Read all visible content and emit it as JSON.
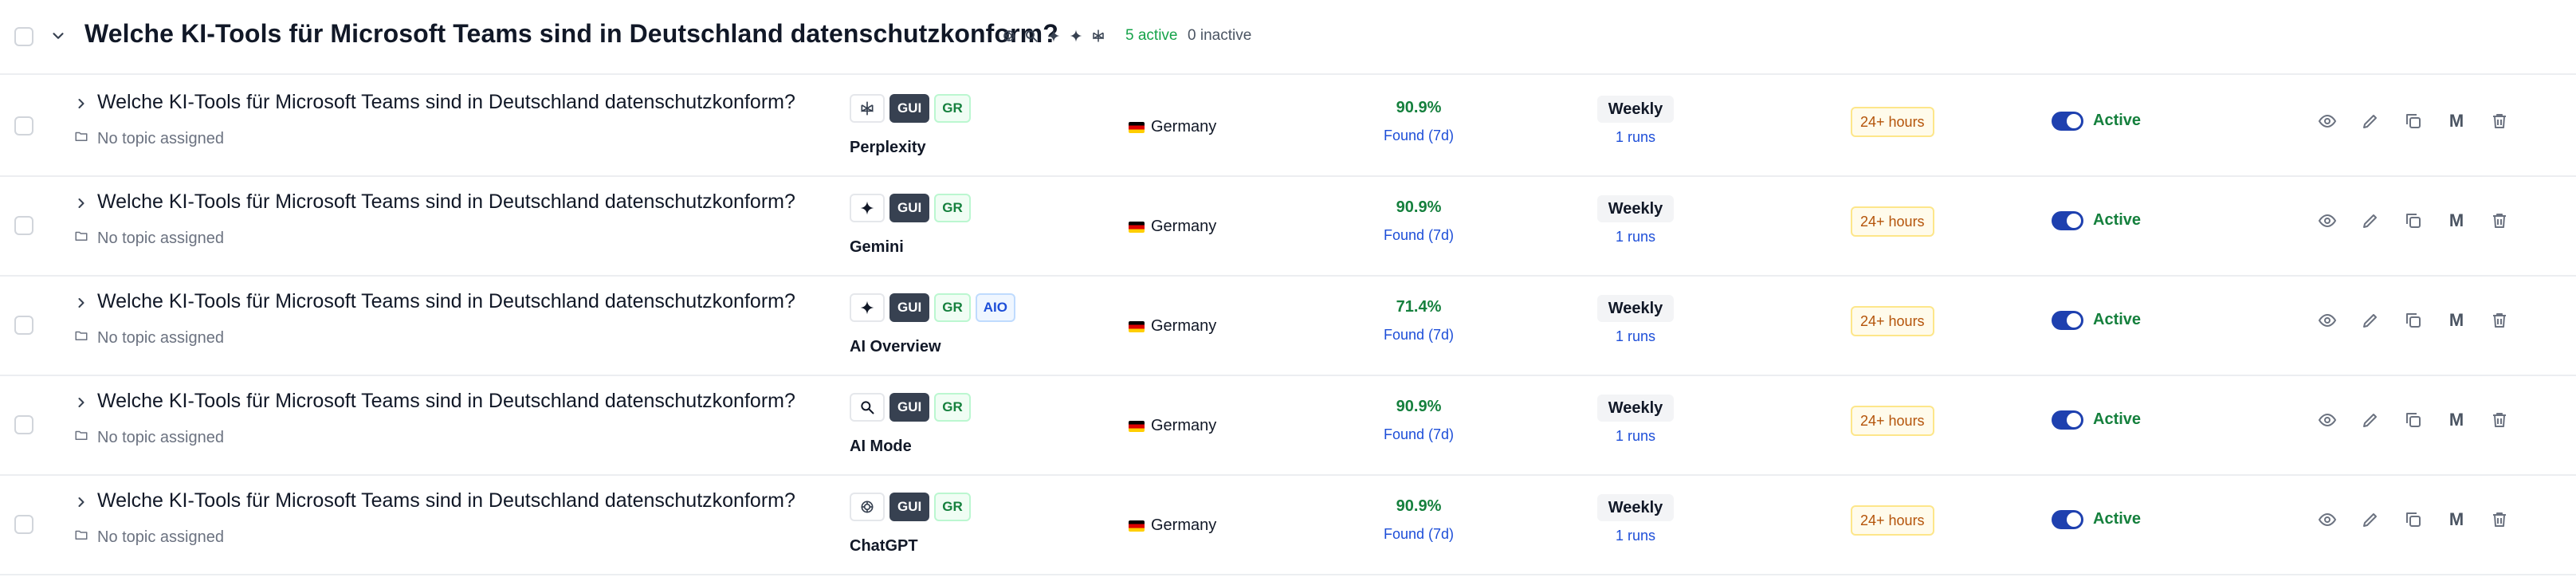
{
  "group": {
    "title": "Welche KI-Tools für Microsoft Teams sind in Deutschland datenschutzkonform?",
    "platform_icons": [
      "chatgpt-icon",
      "ai-mode-icon",
      "gemini-icon",
      "ai-overview-icon",
      "perplexity-icon"
    ],
    "active_count": "5 active",
    "inactive_count": "0 inactive"
  },
  "rows": [
    {
      "question": "Welche KI-Tools für Microsoft Teams sind in Deutschland datenschutzkonform?",
      "topic": "No topic assigned",
      "platform_icon": "perplexity-icon",
      "tags": [
        "GUI",
        "GR"
      ],
      "platform": "Perplexity",
      "country": "Germany",
      "visibility": "90.9%",
      "found": "Found (7d)",
      "frequency": "Weekly",
      "runs": "1 runs",
      "freshness": "24+ hours",
      "status": "Active"
    },
    {
      "question": "Welche KI-Tools für Microsoft Teams sind in Deutschland datenschutzkonform?",
      "topic": "No topic assigned",
      "platform_icon": "gemini-icon",
      "tags": [
        "GUI",
        "GR"
      ],
      "platform": "Gemini",
      "country": "Germany",
      "visibility": "90.9%",
      "found": "Found (7d)",
      "frequency": "Weekly",
      "runs": "1 runs",
      "freshness": "24+ hours",
      "status": "Active"
    },
    {
      "question": "Welche KI-Tools für Microsoft Teams sind in Deutschland datenschutzkonform?",
      "topic": "No topic assigned",
      "platform_icon": "ai-overview-icon",
      "tags": [
        "GUI",
        "GR",
        "AIO"
      ],
      "platform": "AI Overview",
      "country": "Germany",
      "visibility": "71.4%",
      "found": "Found (7d)",
      "frequency": "Weekly",
      "runs": "1 runs",
      "freshness": "24+ hours",
      "status": "Active"
    },
    {
      "question": "Welche KI-Tools für Microsoft Teams sind in Deutschland datenschutzkonform?",
      "topic": "No topic assigned",
      "platform_icon": "ai-mode-icon",
      "tags": [
        "GUI",
        "GR"
      ],
      "platform": "AI Mode",
      "country": "Germany",
      "visibility": "90.9%",
      "found": "Found (7d)",
      "frequency": "Weekly",
      "runs": "1 runs",
      "freshness": "24+ hours",
      "status": "Active"
    },
    {
      "question": "Welche KI-Tools für Microsoft Teams sind in Deutschland datenschutzkonform?",
      "topic": "No topic assigned",
      "platform_icon": "chatgpt-icon",
      "tags": [
        "GUI",
        "GR"
      ],
      "platform": "ChatGPT",
      "country": "Germany",
      "visibility": "90.9%",
      "found": "Found (7d)",
      "frequency": "Weekly",
      "runs": "1 runs",
      "freshness": "24+ hours",
      "status": "Active"
    }
  ],
  "actions": {
    "icons": [
      "eye-icon",
      "pencil-icon",
      "copy-icon",
      "m-icon",
      "trash-icon"
    ],
    "m_label": "M"
  },
  "colors": {
    "active_green": "#15803d",
    "toggle_blue": "#1e40af",
    "link_blue": "#1d4ed8",
    "freshness_amber": "#b45309"
  }
}
